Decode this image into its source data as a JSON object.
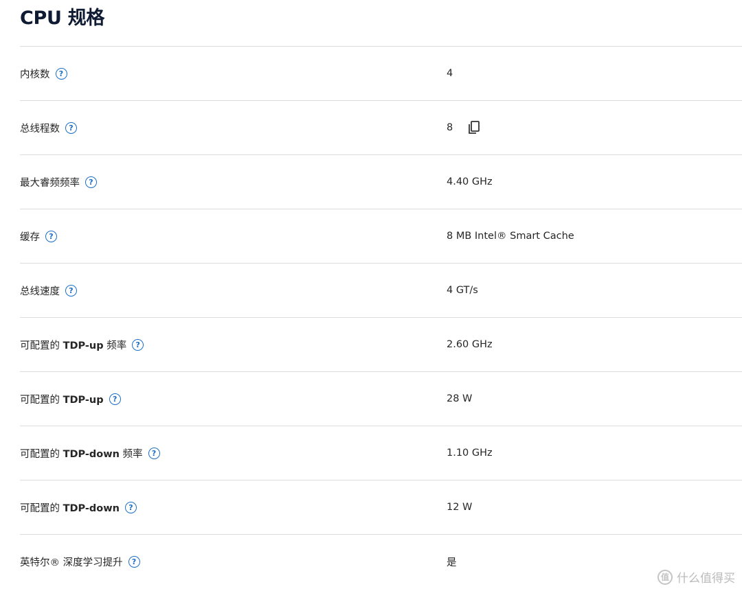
{
  "title": "CPU 规格",
  "help_glyph": "?",
  "specs": [
    {
      "label": "内核数",
      "value": "4"
    },
    {
      "label": "总线程数",
      "value": "8",
      "copy_icon": "copy-icon"
    },
    {
      "label": "最大睿频频率",
      "value": "4.40 GHz"
    },
    {
      "label": "缓存",
      "value": "8 MB Intel® Smart Cache"
    },
    {
      "label": "总线速度",
      "value": "4 GT/s"
    },
    {
      "label_prefix": "可配置的 ",
      "label_bold": "TDP-up",
      "label_suffix": " 频率",
      "value": "2.60 GHz"
    },
    {
      "label_prefix": "可配置的 ",
      "label_bold": "TDP-up",
      "label_suffix": "",
      "value": "28 W"
    },
    {
      "label_prefix": "可配置的 ",
      "label_bold": "TDP-down",
      "label_suffix": " 频率",
      "value": "1.10 GHz"
    },
    {
      "label_prefix": "可配置的 ",
      "label_bold": "TDP-down",
      "label_suffix": "",
      "value": "12 W"
    },
    {
      "label": "英特尔® 深度学习提升",
      "value": "是"
    }
  ],
  "watermark": {
    "glyph": "值",
    "text": "什么值得买"
  },
  "colors": {
    "accent": "#1a6ec8",
    "title": "#0f1b33",
    "divider": "#dcdcdc"
  }
}
